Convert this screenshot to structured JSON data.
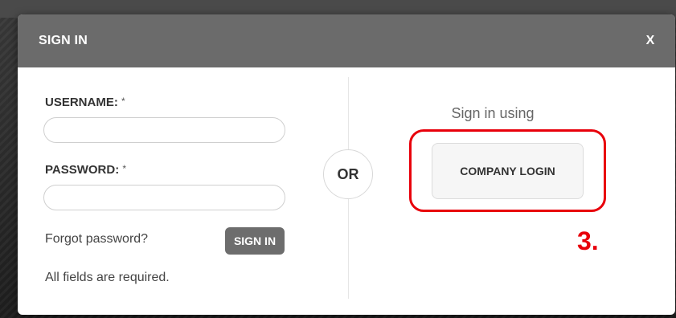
{
  "dialog": {
    "title": "SIGN IN",
    "close_label": "X"
  },
  "form": {
    "username_label": "USERNAME:",
    "password_label": "PASSWORD:",
    "required_marker": "*",
    "username_value": "",
    "password_value": "",
    "forgot_password": "Forgot password?",
    "signin_button": "SIGN IN",
    "required_note": "All fields are required."
  },
  "separator": {
    "label": "OR"
  },
  "sso": {
    "heading": "Sign in using",
    "company_button": "COMPANY LOGIN"
  },
  "annotation": {
    "step": "3.",
    "color": "#e8000b"
  },
  "colors": {
    "header_bg": "#6b6b6b",
    "signin_button_bg": "#6d6d6d"
  }
}
